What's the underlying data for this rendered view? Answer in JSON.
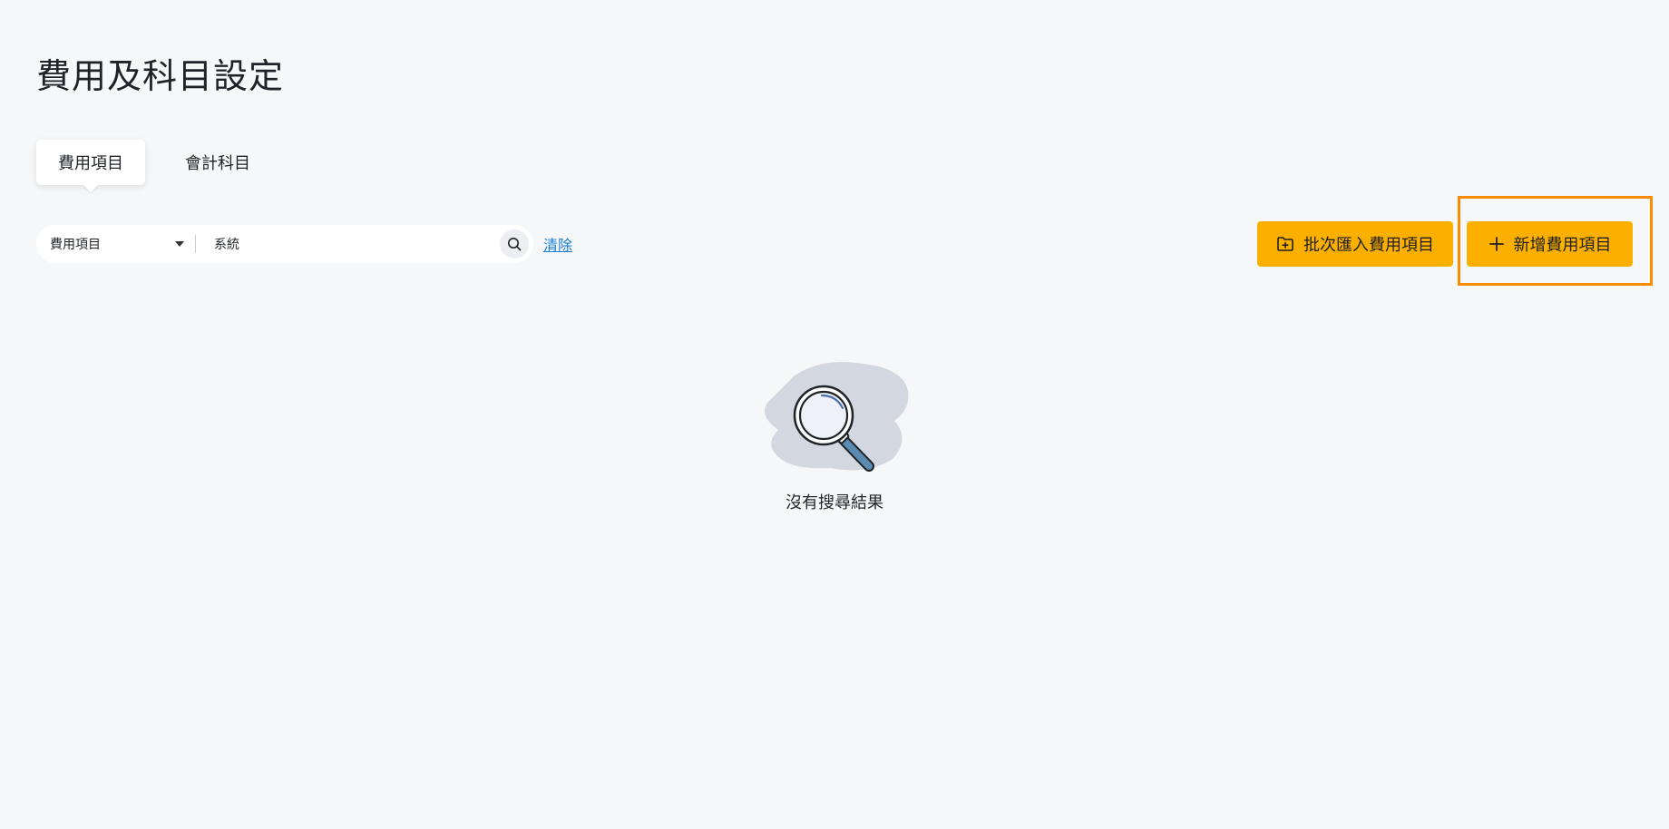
{
  "page": {
    "title": "費用及科目設定"
  },
  "tabs": [
    {
      "label": "費用項目",
      "active": true
    },
    {
      "label": "會計科目",
      "active": false
    }
  ],
  "search": {
    "filter_value": "費用項目",
    "query_value": "系統",
    "clear_label": "清除"
  },
  "toolbar": {
    "import_label": "批次匯入費用項目",
    "add_label": "新增費用項目"
  },
  "empty_state": {
    "message": "沒有搜尋結果"
  },
  "colors": {
    "background": "#f6f7f9",
    "primary_button": "#fbb000",
    "link": "#1a7ed4",
    "highlight": "#ff8c00"
  },
  "icons": {
    "import": "folder-import-icon",
    "add": "plus-icon",
    "search": "search-icon",
    "dropdown": "caret-down-icon",
    "empty": "magnifier-illustration"
  }
}
